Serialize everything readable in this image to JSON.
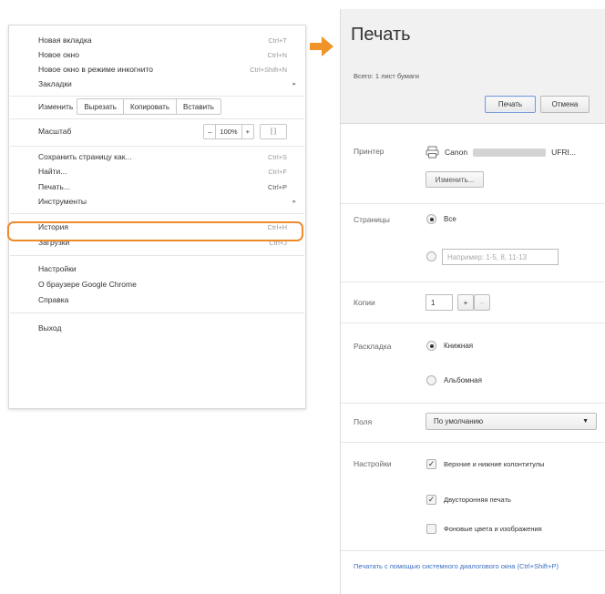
{
  "menu": {
    "items_top": [
      {
        "label": "Новая вкладка",
        "shortcut": "Ctrl+T"
      },
      {
        "label": "Новое окно",
        "shortcut": "Ctrl+N"
      },
      {
        "label": "Новое окно в режиме инкогнито",
        "shortcut": "Ctrl+Shift+N"
      },
      {
        "label": "Закладки",
        "shortcut": ""
      }
    ],
    "edit": {
      "label": "Изменить",
      "cut": "Вырезать",
      "copy": "Копировать",
      "paste": "Вставить"
    },
    "zoom": {
      "label": "Масштаб",
      "minus": "–",
      "value": "100%",
      "plus": "+",
      "fullscreen": "[ ]"
    },
    "items_mid": [
      {
        "label": "Сохранить страницу как...",
        "shortcut": "Ctrl+S"
      },
      {
        "label": "Найти...",
        "shortcut": "Ctrl+F"
      },
      {
        "label": "Печать...",
        "shortcut": "Ctrl+P"
      },
      {
        "label": "Инструменты",
        "shortcut": ""
      }
    ],
    "items_hist": [
      {
        "label": "История",
        "shortcut": "Ctrl+H"
      },
      {
        "label": "Загрузки",
        "shortcut": "Ctrl+J"
      }
    ],
    "items_bottom": [
      {
        "label": "Настройки"
      },
      {
        "label": "О браузере Google Chrome"
      },
      {
        "label": "Справка"
      }
    ],
    "exit": "Выход",
    "submenu_arrow": "▸"
  },
  "print": {
    "title": "Печать",
    "summary": "Всего: 1 лист бумаги",
    "print_button": "Печать",
    "cancel_button": "Отмена",
    "printer_label": "Принтер",
    "printer_name": "Canon",
    "printer_suffix": "UFRI...",
    "change_button": "Изменить...",
    "pages_label": "Страницы",
    "pages_all": "Все",
    "pages_placeholder": "Например: 1-5, 8, 11-13",
    "copies_label": "Копии",
    "copies_value": "1",
    "copies_plus": "+",
    "copies_minus": "–",
    "layout_label": "Раскладка",
    "layout_portrait": "Книжная",
    "layout_landscape": "Альбомная",
    "margins_label": "Поля",
    "margins_value": "По умолчанию",
    "settings_label": "Настройки",
    "opt_headers": "Верхние и нижние колонтитулы",
    "opt_duplex": "Двусторонняя печать",
    "opt_background": "Фоновые цвета и изображения",
    "system_dialog_link": "Печатать с помощью системного диалогового окна (Ctrl+Shift+P)"
  },
  "colors": {
    "highlight": "#ee8a2a",
    "arrow": "#f0942a",
    "link": "#3b6ec5"
  }
}
